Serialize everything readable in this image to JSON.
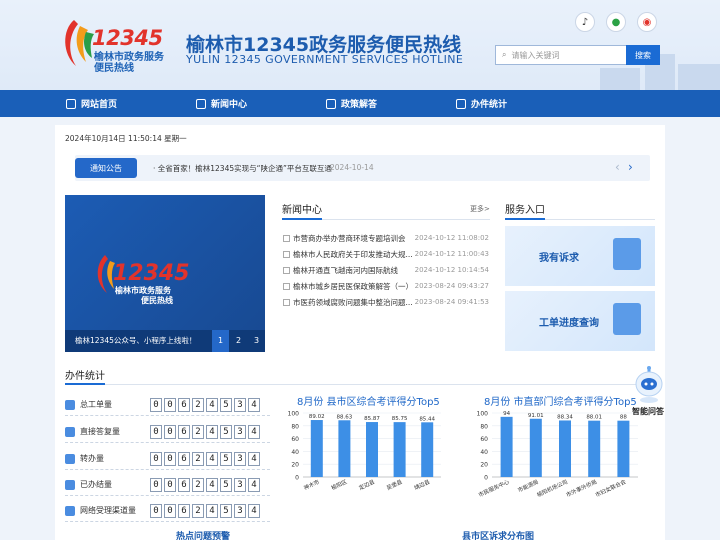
{
  "header": {
    "logo_number": "12345",
    "logo_line1": "榆林市政务服务",
    "logo_line2": "便民热线",
    "title_cn": "榆林市12345政务服务便民热线",
    "title_en": "YULIN 12345 GOVERNMENT SERVICES HOTLINE",
    "search_placeholder": "请输入关键词",
    "search_button": "搜索",
    "social": [
      "douyin-icon",
      "wechat-icon",
      "weibo-icon"
    ]
  },
  "nav": {
    "items": [
      {
        "label": "网站首页",
        "icon": "home-icon"
      },
      {
        "label": "新闻中心",
        "icon": "news-icon"
      },
      {
        "label": "政策解答",
        "icon": "book-icon"
      },
      {
        "label": "办件统计",
        "icon": "chart-icon"
      }
    ]
  },
  "datetime": "2024年10月14日 11:50:14 星期一",
  "notice": {
    "tag": "通知公告",
    "text": "· 全省首家！榆林12345实现与“陕企通”平台互联互通",
    "date": "2024-10-14"
  },
  "banner": {
    "number": "12345",
    "line1": "榆林市政务服务",
    "line2": "便民热线",
    "caption": "榆林12345公众号、小程序上线啦！",
    "pages": [
      "1",
      "2",
      "3"
    ],
    "active_page": "1"
  },
  "news": {
    "title": "新闻中心",
    "more": "更多>",
    "items": [
      {
        "title": "市营商办举办营商环境专题培训会",
        "date": "2024-10-12 11:08:02"
      },
      {
        "title": "榆林市人民政府关于印发推动大规...",
        "date": "2024-10-12 11:00:43"
      },
      {
        "title": "榆林开通直飞越南河内国际航线",
        "date": "2024-10-12 10:14:54"
      },
      {
        "title": "榆林市城乡居民医保政策解答（一）",
        "date": "2023-08-24 09:43:27"
      },
      {
        "title": "市医药领域腐败问题集中整治问题...",
        "date": "2023-08-24 09:41:53"
      }
    ]
  },
  "services": {
    "title": "服务入口",
    "items": [
      {
        "label": "我有诉求",
        "icon": "document-icon"
      },
      {
        "label": "工单进度查询",
        "icon": "search-document-icon"
      }
    ]
  },
  "stats": {
    "title": "办件统计",
    "rows": [
      {
        "label": "总工单量",
        "digits": [
          "0",
          "0",
          "6",
          "2",
          "4",
          "5",
          "3",
          "4"
        ],
        "icon": "layers-icon"
      },
      {
        "label": "直接答复量",
        "digits": [
          "0",
          "0",
          "6",
          "2",
          "4",
          "5",
          "3",
          "4"
        ],
        "icon": "list-icon"
      },
      {
        "label": "转办量",
        "digits": [
          "0",
          "0",
          "6",
          "2",
          "4",
          "5",
          "3",
          "4"
        ],
        "icon": "transfer-icon"
      },
      {
        "label": "已办结量",
        "digits": [
          "0",
          "0",
          "6",
          "2",
          "4",
          "5",
          "3",
          "4"
        ],
        "icon": "check-icon"
      },
      {
        "label": "网络受理渠道量",
        "digits": [
          "0",
          "0",
          "6",
          "2",
          "4",
          "5",
          "3",
          "4"
        ],
        "icon": "network-icon"
      }
    ]
  },
  "chart_data": [
    {
      "type": "bar",
      "title": "8月份 县市区综合考评得分Top5",
      "categories": [
        "神木市",
        "榆阳区",
        "定边县",
        "吴堡县",
        "靖边县"
      ],
      "values": [
        89.02,
        88.63,
        85.87,
        85.75,
        85.44
      ],
      "yticks": [
        "0",
        "20",
        "40",
        "60",
        "80",
        "100"
      ],
      "ylim": [
        0,
        100
      ],
      "color": "#3d8fe6"
    },
    {
      "type": "bar",
      "title": "8月份 市直部门综合考评得分Top5",
      "categories": [
        "市民服务中心",
        "市能源局",
        "榆阳机场公司",
        "市外事外侨局",
        "市妇女联合会"
      ],
      "values": [
        94,
        91.01,
        88.34,
        88.01,
        88
      ],
      "yticks": [
        "0",
        "20",
        "40",
        "60",
        "80",
        "100"
      ],
      "ylim": [
        0,
        100
      ],
      "color": "#3d8fe6"
    }
  ],
  "robot_label": "智能问答",
  "bottom": {
    "left_title": "热点问题预警",
    "right_title": "县市区诉求分布图"
  }
}
